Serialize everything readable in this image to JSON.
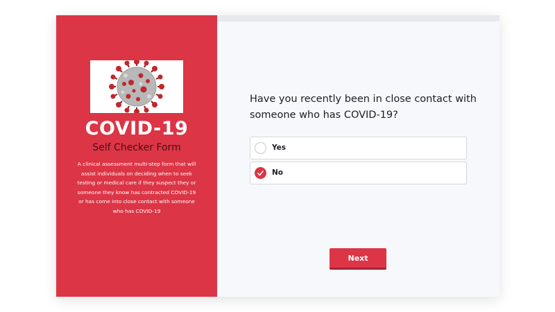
{
  "left_panel": {
    "title": "COVID-19",
    "subtitle": "Self Checker Form",
    "description": "A clinical assessment multi-step form that will assist individuals on deciding when to seek testing or medical care if they suspect they or someone they know has contracted COVID-19 or has come into close contact with someone who has COVID-19",
    "image_icon": "coronavirus-icon"
  },
  "question": {
    "text": "Have you recently been in close contact with someone who has COVID-19?",
    "options": [
      {
        "label": "Yes",
        "selected": false
      },
      {
        "label": "No",
        "selected": true
      }
    ]
  },
  "actions": {
    "next_label": "Next"
  },
  "colors": {
    "accent": "#dc3546",
    "subtitle": "#4a0d14",
    "background": "#f7f8fb"
  }
}
